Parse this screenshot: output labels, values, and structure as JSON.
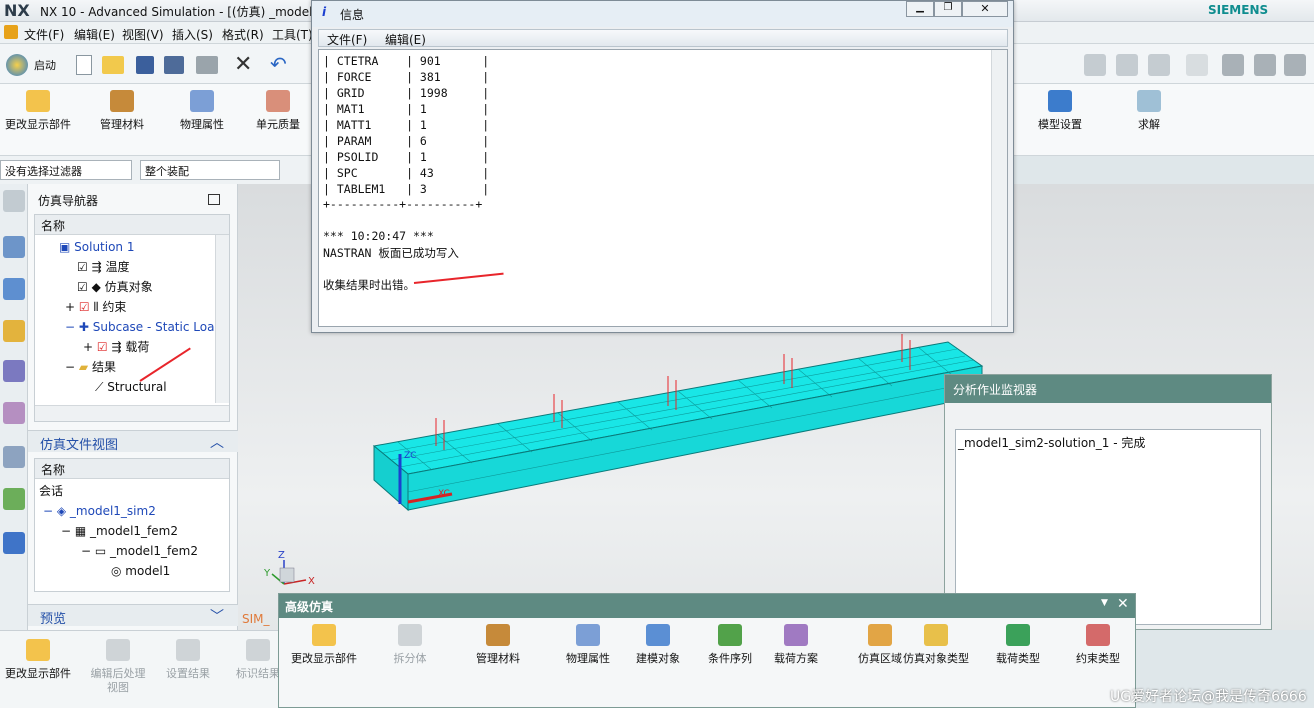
{
  "window": {
    "title": "NX 10 - Advanced Simulation - [(仿真) _model1",
    "brand": "SIEMENS"
  },
  "menu": [
    "文件(F)",
    "编辑(E)",
    "视图(V)",
    "插入(S)",
    "格式(R)",
    "工具(T)"
  ],
  "toolbar": {
    "start_label": "启动"
  },
  "ribbon": {
    "items": [
      "更改显示部件",
      "管理材料",
      "物理属性",
      "单元质量"
    ],
    "right_items": [
      "模型设置",
      "求解"
    ]
  },
  "filters": {
    "selection": "没有选择过滤器",
    "assembly": "整个装配"
  },
  "navigator": {
    "title": "仿真导航器",
    "col_header": "名称",
    "rows": [
      "Solution 1",
      "温度",
      "仿真对象",
      "约束",
      "Subcase - Static Loa",
      "载荷",
      "结果",
      "Structural"
    ]
  },
  "file_view": {
    "title": "仿真文件视图",
    "col_header": "名称",
    "rows": [
      "会话",
      "_model1_sim2",
      "_model1_fem2",
      "_model1_fem2",
      "model1"
    ]
  },
  "preview_label": "预览",
  "info_dialog": {
    "title": "信息",
    "menu": [
      "文件(F)",
      "编辑(E)"
    ],
    "table": [
      [
        "CTETRA",
        "901"
      ],
      [
        "FORCE",
        "381"
      ],
      [
        "GRID",
        "1998"
      ],
      [
        "MAT1",
        "1"
      ],
      [
        "MATT1",
        "1"
      ],
      [
        "PARAM",
        "6"
      ],
      [
        "PSOLID",
        "1"
      ],
      [
        "SPC",
        "43"
      ],
      [
        "TABLEM1",
        "3"
      ]
    ],
    "footer_rule": "+----------+----------+",
    "time": "*** 10:20:47 ***",
    "msg1": "NASTRAN 板面已成功写入",
    "msg2": "收集结果时出错。"
  },
  "monitor": {
    "title": "分析作业监视器",
    "job": "_model1_sim2-solution_1 - 完成"
  },
  "adv_bar": {
    "title": "高级仿真",
    "items": [
      "更改显示部件",
      "拆分体",
      "管理材料",
      "物理属性",
      "建模对象",
      "条件序列",
      "载荷方案",
      "仿真区域",
      "仿真对象类型",
      "载荷类型",
      "约束类型"
    ]
  },
  "bottom_left": {
    "items": [
      "更改显示部件",
      "编辑后处理视图",
      "设置结果",
      "标识结果"
    ]
  },
  "viewport": {
    "tab": "SIM_",
    "axes": [
      "ZC",
      "XC",
      "Z",
      "Y",
      "X"
    ]
  },
  "watermark": "UG爱好者论坛@我是传奇6666",
  "colors": {
    "mesh": "#19e6e6",
    "accent": "#5a8a82",
    "arrow": "#e8252b"
  }
}
